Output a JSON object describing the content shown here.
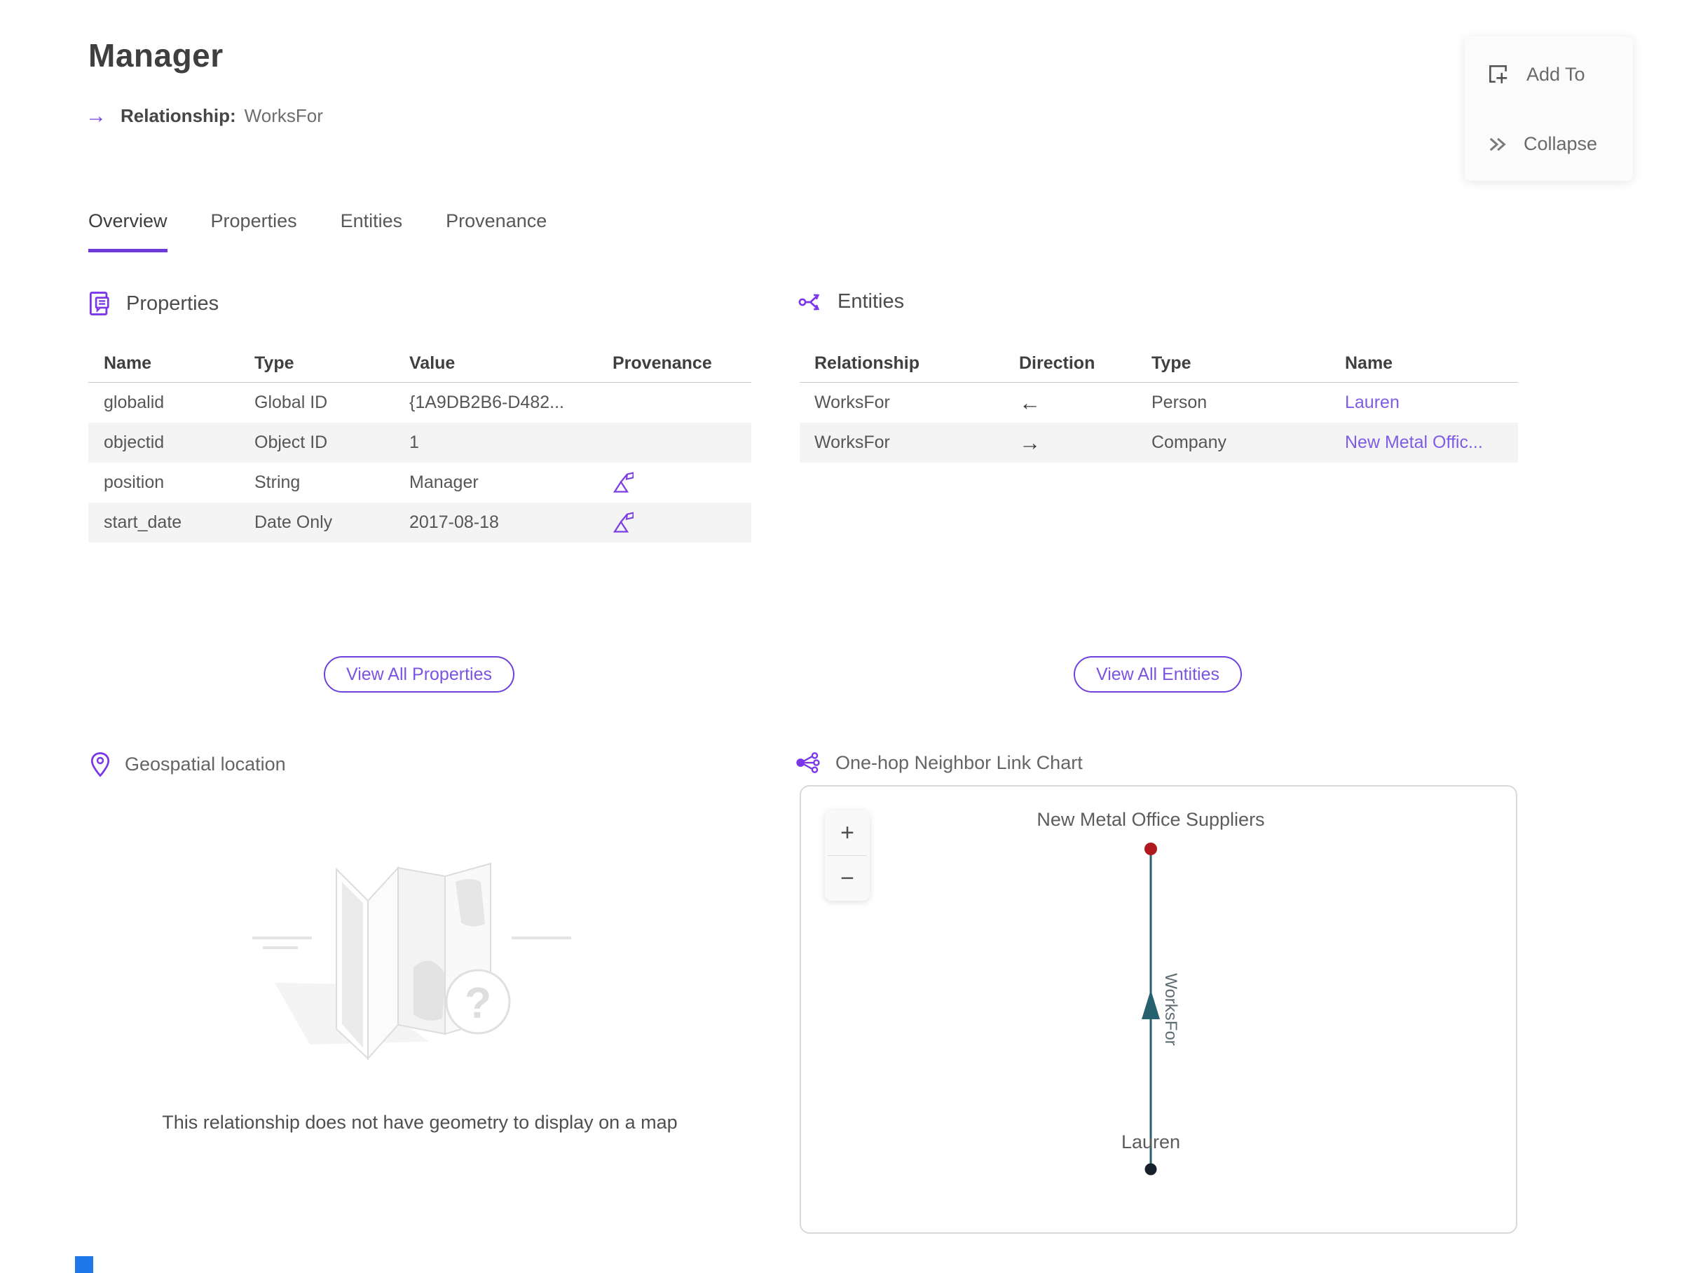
{
  "page": {
    "title": "Manager",
    "subtitle_label": "Relationship:",
    "subtitle_value": "WorksFor",
    "subtitle_arrow": "→"
  },
  "action_panel": {
    "add_to_label": "Add To",
    "collapse_label": "Collapse"
  },
  "tabs": {
    "overview": "Overview",
    "properties": "Properties",
    "entities": "Entities",
    "provenance": "Provenance"
  },
  "properties_section": {
    "title": "Properties",
    "headers": {
      "name": "Name",
      "type": "Type",
      "value": "Value",
      "provenance": "Provenance"
    },
    "rows": [
      {
        "name": "globalid",
        "type": "Global ID",
        "value": "{1A9DB2B6-D482..."
      },
      {
        "name": "objectid",
        "type": "Object ID",
        "value": "1"
      },
      {
        "name": "position",
        "type": "String",
        "value": "Manager"
      },
      {
        "name": "start_date",
        "type": "Date Only",
        "value": "2017-08-18"
      }
    ],
    "view_all_label": "View All Properties"
  },
  "entities_section": {
    "title": "Entities",
    "headers": {
      "relationship": "Relationship",
      "direction": "Direction",
      "type": "Type",
      "name": "Name"
    },
    "rows": [
      {
        "relationship": "WorksFor",
        "direction": "←",
        "type": "Person",
        "name": "Lauren"
      },
      {
        "relationship": "WorksFor",
        "direction": "→",
        "type": "Company",
        "name": "New Metal Offic..."
      }
    ],
    "view_all_label": "View All Entities"
  },
  "geospatial_section": {
    "title": "Geospatial location",
    "empty_message": "This relationship does not have geometry to display on a map",
    "placeholder_glyph": "?"
  },
  "link_chart_section": {
    "title": "One-hop Neighbor Link Chart",
    "zoom_in_label": "+",
    "zoom_out_label": "−",
    "top_node_label": "New Metal Office Suppliers",
    "bottom_node_label": "Lauren",
    "edge_label": "WorksFor"
  },
  "colors": {
    "accent_purple": "#7642e0",
    "link_purple": "#7d5ce6",
    "edge_teal": "#27606e",
    "node_red": "#ae1a1f",
    "node_navy": "#16212c",
    "row_stripe": "#f4f4f4"
  }
}
